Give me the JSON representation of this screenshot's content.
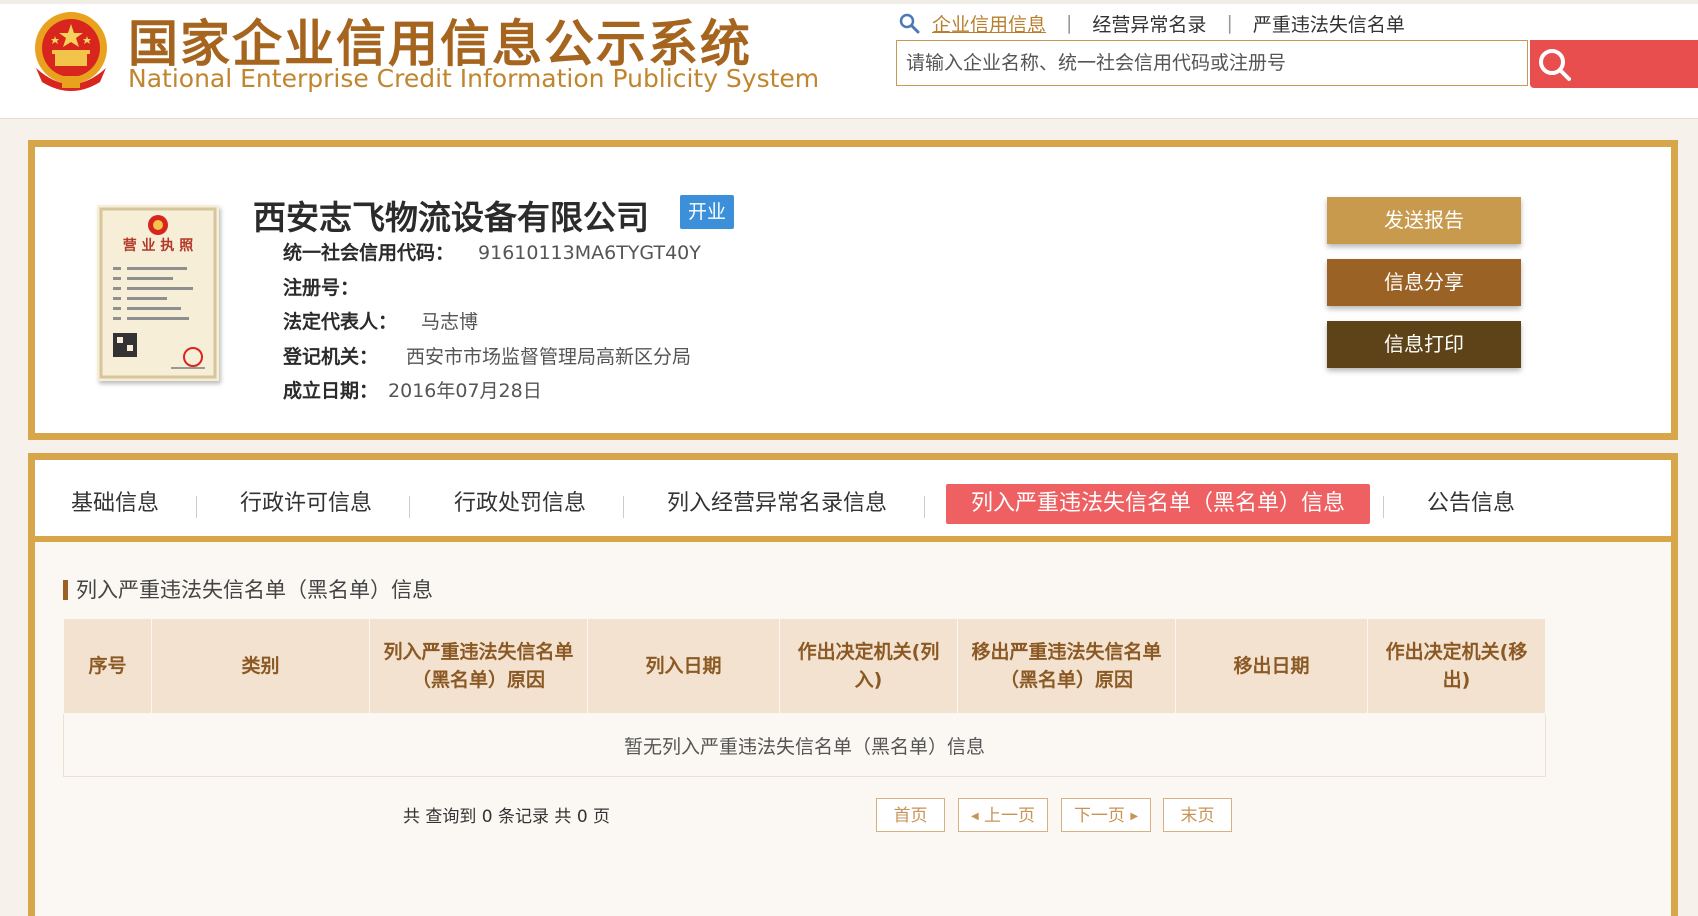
{
  "site": {
    "title_cn": "国家企业信用信息公示系统",
    "title_en": "National Enterprise Credit Information Publicity System"
  },
  "top_nav": {
    "items": [
      {
        "label": "企业信用信息",
        "active": true
      },
      {
        "label": "经营异常名录",
        "active": false
      },
      {
        "label": "严重违法失信名单",
        "active": false
      }
    ]
  },
  "search": {
    "placeholder": "请输入企业名称、统一社会信用代码或注册号"
  },
  "company": {
    "name": "西安志飞物流设备有限公司",
    "status": "开业",
    "fields": [
      {
        "label": "统一社会信用代码：",
        "value": "91610113MA6TYGT40Y"
      },
      {
        "label": "注册号：",
        "value": ""
      },
      {
        "label": "法定代表人：",
        "value": "马志博"
      },
      {
        "label": "登记机关：",
        "value": "西安市市场监督管理局高新区分局"
      },
      {
        "label": "成立日期：",
        "value": "2016年07月28日"
      }
    ]
  },
  "license_image": {
    "title": "营 业 执 照"
  },
  "actions": {
    "send_report": "发送报告",
    "share": "信息分享",
    "print": "信息打印"
  },
  "tabs": [
    {
      "label": "基础信息",
      "active": false
    },
    {
      "label": "行政许可信息",
      "active": false
    },
    {
      "label": "行政处罚信息",
      "active": false
    },
    {
      "label": "列入经营异常名录信息",
      "active": false
    },
    {
      "label": "列入严重违法失信名单（黑名单）信息",
      "active": true
    },
    {
      "label": "公告信息",
      "active": false
    }
  ],
  "section": {
    "title": "列入严重违法失信名单（黑名单）信息"
  },
  "table": {
    "headers": [
      "序号",
      "类别",
      "列入严重违法失信名单（黑名单）原因",
      "列入日期",
      "作出决定机关(列入)",
      "移出严重违法失信名单（黑名单）原因",
      "移出日期",
      "作出决定机关(移出)"
    ],
    "empty_message": "暂无列入严重违法失信名单（黑名单）信息"
  },
  "pager": {
    "summary": "共 查询到 0 条记录 共 0 页",
    "first": "首页",
    "prev": "上一页",
    "next": "下一页",
    "last": "末页"
  },
  "colors": {
    "brand_gold": "#d7a64b",
    "title_brown": "#a5651f",
    "active_tab": "#ee6062",
    "status_blue": "#3c8fd9",
    "search_red": "#e94e4e"
  }
}
